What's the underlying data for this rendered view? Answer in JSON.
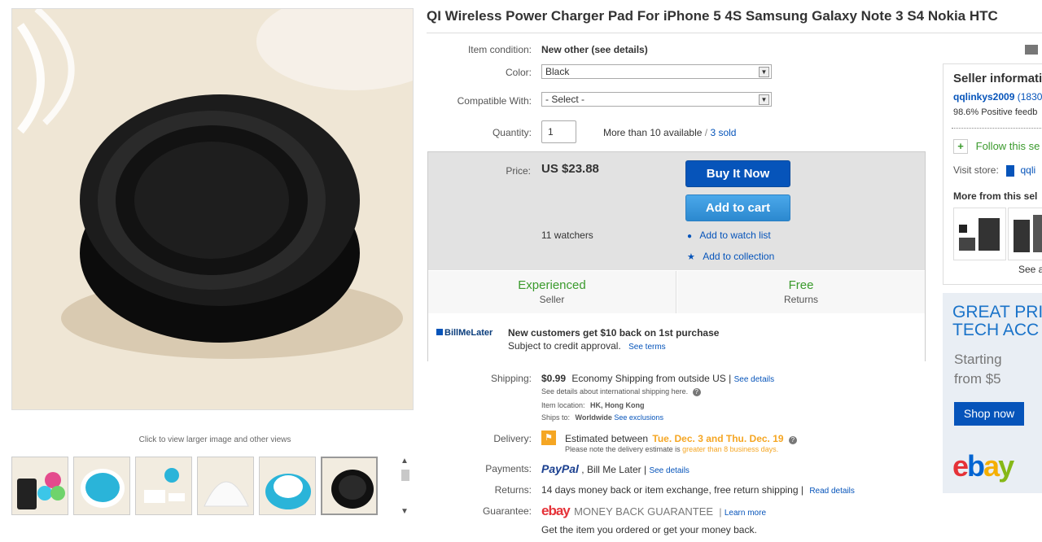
{
  "image": {
    "caption": "Click to view larger image and other views"
  },
  "title": "QI Wireless Power Charger Pad For iPhone 5 4S Samsung Galaxy Note 3 S4 Nokia HTC",
  "condition": {
    "label": "Item condition:",
    "value": "New other (see details)"
  },
  "color": {
    "label": "Color:",
    "value": "Black"
  },
  "compat": {
    "label": "Compatible With:",
    "value": "- Select -"
  },
  "quantity": {
    "label": "Quantity:",
    "value": "1",
    "available": "More than 10 available",
    "sep": "/",
    "sold": "3 sold"
  },
  "price": {
    "label": "Price:",
    "value": "US $23.88",
    "watchers": "11 watchers"
  },
  "buttons": {
    "buy": "Buy It Now",
    "cart": "Add to cart",
    "watch": "Add to watch list",
    "collection": "Add to collection"
  },
  "highlights": [
    {
      "big": "Experienced",
      "small": "Seller"
    },
    {
      "big": "Free",
      "small": "Returns"
    }
  ],
  "billmelater": {
    "logo": "BillMeLater",
    "headline": "New customers get $10 back on 1st purchase",
    "sub": "Subject to credit approval.",
    "terms": "See terms"
  },
  "shipping": {
    "label": "Shipping:",
    "cost": "$0.99",
    "method": "Economy Shipping from outside US |",
    "details": "See details",
    "intl": "See details about international shipping here.",
    "location_label": "Item location:",
    "location": "HK, Hong Kong",
    "shipsto_label": "Ships to:",
    "shipsto": "Worldwide",
    "exclusions": "See exclusions"
  },
  "delivery": {
    "label": "Delivery:",
    "estimated": "Estimated between",
    "dates": "Tue. Dec. 3 and Thu. Dec. 19",
    "note": "Please note the delivery estimate is",
    "note_hl": "greater than 8 business days."
  },
  "payments": {
    "label": "Payments:",
    "paypal": "PayPal",
    "rest": ", Bill Me Later |",
    "details": "See details"
  },
  "returns": {
    "label": "Returns:",
    "text": "14 days money back or item exchange, free return shipping |",
    "details": "Read details"
  },
  "guarantee": {
    "label": "Guarantee:",
    "ebay": "ebay",
    "mbg": "MONEY BACK GUARANTEE",
    "learn": "Learn more",
    "sub": "Get the item you ordered or get your money back."
  },
  "seller": {
    "heading": "Seller informati",
    "name": "qqlinkys2009",
    "score": "(1830",
    "feedback": "98.6% Positive feedb",
    "follow": "Follow this se",
    "visit": "Visit store:",
    "store": "qqli",
    "more": "More from this sel",
    "see_all": "See a"
  },
  "promo": {
    "line1": "GREAT PRI",
    "line2": "TECH ACC",
    "starting": "Starting",
    "from": "from $5",
    "shop": "Shop now",
    "logo": "ebay"
  },
  "colors": {
    "accent_blue": "#0654ba",
    "green": "#3a9a2c",
    "orange": "#f5a623"
  }
}
